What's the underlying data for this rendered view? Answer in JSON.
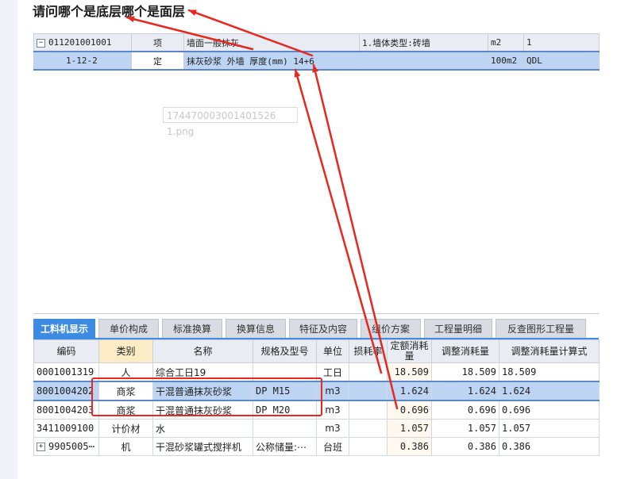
{
  "question": "请问哪个是底层哪个是面层",
  "upper_table": {
    "rows": [
      {
        "code": "011201001001",
        "type": "项",
        "name": "墙面一般抹灰",
        "feature": "1.墙体类型:砖墙",
        "unit": "m2",
        "qty": "1",
        "expander": "−"
      },
      {
        "code": "1-12-2",
        "type": "定",
        "name": "抹灰砂浆 外墙 厚度(mm) 14+6",
        "feature": "",
        "unit": "100m2",
        "qty": "QDL"
      }
    ]
  },
  "watermark": "174470003001401526​1.png",
  "tabs": [
    "工料机显示",
    "单价构成",
    "标准换算",
    "换算信息",
    "特征及内容",
    "组价方案",
    "工程量明细",
    "反查图形工程量"
  ],
  "lower_table": {
    "headers": [
      "编码",
      "类别",
      "名称",
      "规格及型号",
      "单位",
      "损耗率",
      "定额消耗量",
      "调整消耗量",
      "调整消耗量计算式"
    ],
    "rows": [
      {
        "code": "0001001319",
        "type": "人",
        "name": "综合工日19",
        "spec": "",
        "unit": "工日",
        "loss": "",
        "quota": "18.509",
        "adjusted": "18.509",
        "formula": "18.509"
      },
      {
        "code": "8001004202",
        "type": "商浆",
        "name": "干混普通抹灰砂浆",
        "spec": "DP M15",
        "unit": "m3",
        "loss": "",
        "quota": "1.624",
        "adjusted": "1.624",
        "formula": "1.624"
      },
      {
        "code": "8001004203",
        "type": "商浆",
        "name": "干混普通抹灰砂浆",
        "spec": "DP M20",
        "unit": "m3",
        "loss": "",
        "quota": "0.696",
        "adjusted": "0.696",
        "formula": "0.696"
      },
      {
        "code": "3411009100",
        "type": "计价材",
        "name": "水",
        "spec": "",
        "unit": "m3",
        "loss": "",
        "quota": "1.057",
        "adjusted": "1.057",
        "formula": "1.057"
      },
      {
        "code": "9905005⋯",
        "type": "机",
        "name": "干混砂浆罐式搅拌机",
        "spec": "公称储量:⋯",
        "unit": "台班",
        "loss": "",
        "quota": "0.386",
        "adjusted": "0.386",
        "formula": "0.386",
        "expander": "+"
      }
    ]
  },
  "colors": {
    "annotation_red": "#e8281f",
    "active_tab": "#3d8be3",
    "selected_row": "#bed4f3"
  }
}
